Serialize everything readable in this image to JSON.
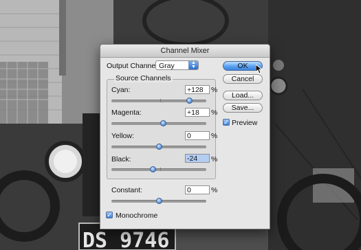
{
  "dialog": {
    "title": "Channel Mixer",
    "output_channel_label": "Output Channel:",
    "output_channel_value": "Gray",
    "source_channels_label": "Source Channels",
    "channels": [
      {
        "label": "Cyan:",
        "value": "+128",
        "unit": "%",
        "slider_fraction": 0.82
      },
      {
        "label": "Magenta:",
        "value": "+18",
        "unit": "%",
        "slider_fraction": 0.55
      },
      {
        "label": "Yellow:",
        "value": "0",
        "unit": "%",
        "slider_fraction": 0.5
      },
      {
        "label": "Black:",
        "value": "-24",
        "unit": "%",
        "slider_fraction": 0.44
      }
    ],
    "constant": {
      "label": "Constant:",
      "value": "0",
      "unit": "%",
      "slider_fraction": 0.5
    },
    "monochrome_label": "Monochrome",
    "monochrome_checked": true,
    "buttons": {
      "ok": "OK",
      "cancel": "Cancel",
      "load": "Load...",
      "save": "Save..."
    },
    "preview_label": "Preview",
    "preview_checked": true
  },
  "background": {
    "plate_text": "DS 9746"
  }
}
